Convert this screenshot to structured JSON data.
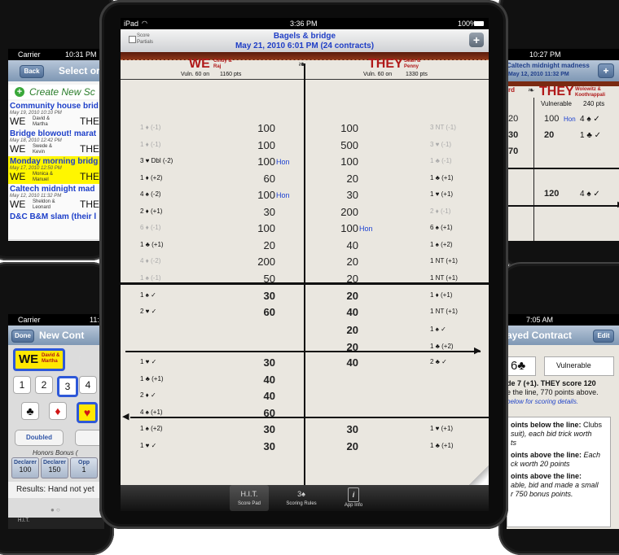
{
  "ipad": {
    "status": {
      "carrier": "iPad",
      "time": "3:36 PM",
      "battery": "100%"
    },
    "nav": {
      "score_partials": "Score Partials",
      "title": "Bagels & bridge",
      "subtitle": "May 21, 2010 6:01 PM (24 contracts)",
      "plus": "+"
    },
    "header": {
      "we": "WE",
      "we_names": "Cindy & Raj",
      "we_vuln": "Vuln. 60 on",
      "we_pts": "1160 pts",
      "they": "THEY",
      "they_names": "Sean & Penny",
      "they_vuln": "Vuln. 60 on",
      "they_pts": "1330 pts"
    },
    "above_rows": [
      {
        "we_contract": "1 ♦ (-1)",
        "we_dim": true,
        "we": "100",
        "we_hon": "",
        "they": "100",
        "they_hon": "",
        "they_contract": "3 NT (-1)",
        "they_dim": true
      },
      {
        "we_contract": "1 ♦ (-1)",
        "we_dim": true,
        "we": "100",
        "we_hon": "",
        "they": "500",
        "they_hon": "",
        "they_contract": "3 ♥ (-1)",
        "they_dim": true
      },
      {
        "we_contract": "3 ♥ Dbl (-2)",
        "we_dim": false,
        "we": "100",
        "we_hon": "Hon",
        "they": "100",
        "they_hon": "",
        "they_contract": "1 ♣ (-1)",
        "they_dim": true
      },
      {
        "we_contract": "1 ♦ (+2)",
        "we_dim": false,
        "we": "60",
        "we_hon": "",
        "they": "20",
        "they_hon": "",
        "they_contract": "1 ♣ (+1)",
        "they_dim": false
      },
      {
        "we_contract": "4 ♠ (-2)",
        "we_dim": false,
        "we": "100",
        "we_hon": "Hon",
        "they": "30",
        "they_hon": "",
        "they_contract": "1 ♥ (+1)",
        "they_dim": false
      },
      {
        "we_contract": "2 ♦ (+1)",
        "we_dim": false,
        "we": "30",
        "we_hon": "",
        "they": "200",
        "they_hon": "",
        "they_contract": "2 ♦ (-1)",
        "they_dim": true
      },
      {
        "we_contract": "6 ♦ (-1)",
        "we_dim": true,
        "we": "100",
        "we_hon": "",
        "they": "100",
        "they_hon": "Hon",
        "they_contract": "6 ♠ (+1)",
        "they_dim": false
      },
      {
        "we_contract": "1 ♣ (+1)",
        "we_dim": false,
        "we": "20",
        "we_hon": "",
        "they": "40",
        "they_hon": "",
        "they_contract": "1 ♠ (+2)",
        "they_dim": false
      },
      {
        "we_contract": "4 ♦ (-2)",
        "we_dim": true,
        "we": "200",
        "we_hon": "",
        "they": "20",
        "they_hon": "",
        "they_contract": "1 NT (+1)",
        "they_dim": false
      },
      {
        "we_contract": "1 ♠ (-1)",
        "we_dim": true,
        "we": "50",
        "we_hon": "",
        "they": "20",
        "they_hon": "",
        "they_contract": "1 NT (+1)",
        "they_dim": false
      }
    ],
    "below_rows": [
      {
        "we_contract": "1 ♠ ✓",
        "we": "30",
        "they": "20",
        "they_contract": "1 ♦ (+1)"
      },
      {
        "we_contract": "2 ♥ ✓",
        "we": "60",
        "they": "40",
        "they_contract": "1 NT (+1)"
      },
      {
        "we_contract": "",
        "we": "",
        "they": "20",
        "they_contract": "1 ♠ ✓"
      },
      {
        "we_contract": "",
        "we": "",
        "they": "20",
        "they_contract": "1 ♣ (+2)"
      },
      {
        "we_contract": "1 ♥ ✓",
        "we": "30",
        "they": "40",
        "they_contract": "2 ♣ ✓"
      },
      {
        "we_contract": "1 ♣ (+1)",
        "we": "40",
        "they": "",
        "they_contract": ""
      },
      {
        "we_contract": "2 ♦ ✓",
        "we": "40",
        "they": "",
        "they_contract": ""
      },
      {
        "we_contract": "4 ♠ (+1)",
        "we": "60",
        "they": "",
        "they_contract": ""
      },
      {
        "we_contract": "1 ♠ (+2)",
        "we": "30",
        "they": "30",
        "they_contract": "1 ♥ (+1)"
      },
      {
        "we_contract": "1 ♥ ✓",
        "we": "30",
        "they": "20",
        "they_contract": "1 ♣ (+1)"
      }
    ],
    "tabs": [
      {
        "label": "Score Pad",
        "icon": "H.I.T."
      },
      {
        "label": "Scoring Rules",
        "icon": "3♠"
      },
      {
        "label": "App Info",
        "icon": "i"
      }
    ]
  },
  "phone_top_left": {
    "status": {
      "carrier": "Carrier",
      "time": "10:31 PM"
    },
    "nav": {
      "back": "Back",
      "title": "Select or"
    },
    "create": "Create New Sc",
    "games": [
      {
        "title": "Community house brid",
        "date": "May 19, 2010 10:10 PM",
        "we_names": "David & Martha",
        "they": "THE",
        "highlight": false
      },
      {
        "title": "Bridge blowout! marat",
        "date": "May 18, 2010 12:42 PM",
        "we_names": "Swede & Kevin",
        "they": "THE",
        "highlight": false
      },
      {
        "title": "Monday morning bridg",
        "date": "May 17, 2010 12:50 PM",
        "we_names": "Monica & Manuel",
        "they": "THE",
        "highlight": true
      },
      {
        "title": "Caltech midnight mad",
        "date": "May 12, 2010 11:32 PM",
        "we_names": "Sheldon & Leonard",
        "they": "THE",
        "highlight": false
      },
      {
        "title": "D&C B&M slam (their l",
        "date": "",
        "we_names": "",
        "they": "",
        "highlight": false
      }
    ],
    "we": "WE"
  },
  "phone_top_right": {
    "time": "10:27 PM",
    "title": "Caltech midnight madness",
    "date": "May 12, 2010 11:32 PM",
    "plus": "+",
    "they": "THEY",
    "they_names": "Wolowitz & Koothrappali",
    "vulnerable": "Vulnerable",
    "pts": "240 pts",
    "rows": [
      {
        "a": "20",
        "b": "100",
        "hon": "Hon",
        "c": "4 ♠ ✓"
      },
      {
        "a": "30",
        "b": "20",
        "hon": "",
        "c": "1 ♣ ✓"
      },
      {
        "a": "70",
        "b": "",
        "hon": "",
        "c": ""
      },
      {
        "a": "",
        "b": "120",
        "hon": "",
        "c": "4 ♠ ✓"
      }
    ],
    "left_partial_a": "rd",
    "left_partial_b": "s"
  },
  "phone_bottom_left": {
    "status": {
      "carrier": "Carrier",
      "time": "11:"
    },
    "nav": {
      "done": "Done",
      "title": "New Cont"
    },
    "we": "WE",
    "we_names": "David & Martha",
    "levels": [
      "1",
      "2",
      "3",
      "4"
    ],
    "selected_level": "3",
    "suits": [
      "♣",
      "♦",
      "♥"
    ],
    "doubled": "Doubled",
    "honors_title": "Honors Bonus (",
    "honors": [
      {
        "label": "Declarer",
        "value": "100"
      },
      {
        "label": "Declarer",
        "value": "150"
      },
      {
        "label": "Opp",
        "value": "1"
      }
    ],
    "result": "Results: Hand not yet",
    "tab_icon": "H.I.T."
  },
  "phone_bottom_right": {
    "time": "7:05 AM",
    "title": "ayed Contract",
    "edit": "Edit",
    "contract": "6♣",
    "vulnerable": "Vulnerable",
    "line1": "de 7 (+1). THEY score 120",
    "line2": "e the line, 770 points above.",
    "link": "below for scoring details.",
    "rule1_title": "oints below the line:",
    "rule1_a": " Clubs",
    "rule1_b": "suit), each bid trick worth",
    "rule1_c": "ts",
    "rule2_title": "oints above the line:",
    "rule2_a": " Each",
    "rule2_b": "ck worth 20 points",
    "rule3_title": "oints above the line:",
    "rule3_b": "able, bid and made a small",
    "rule3_c": "r 750 bonus points."
  }
}
